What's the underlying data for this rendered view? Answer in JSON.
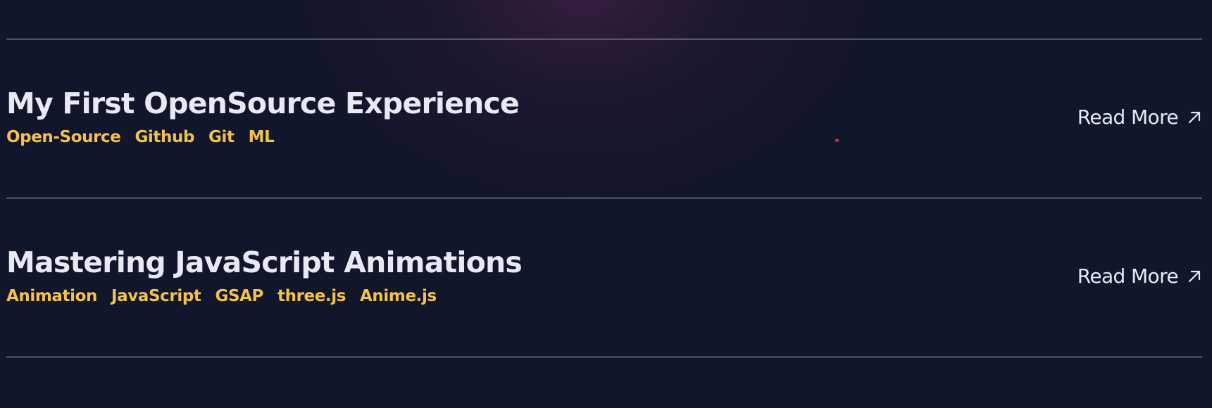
{
  "posts": [
    {
      "title": "My First OpenSource Experience",
      "tags": [
        "Open-Source",
        "Github",
        "Git",
        "ML"
      ],
      "read_more_label": "Read More"
    },
    {
      "title": "Mastering JavaScript Animations",
      "tags": [
        "Animation",
        "JavaScript",
        "GSAP",
        "three.js",
        "Anime.js"
      ],
      "read_more_label": "Read More"
    }
  ],
  "icons": {
    "read_more": "arrow-up-right-icon"
  },
  "colors": {
    "background": "#11162a",
    "title": "#e7eaf3",
    "tag": "#f2c14f",
    "divider": "#b9bcc6",
    "glow": "#6e285a"
  }
}
